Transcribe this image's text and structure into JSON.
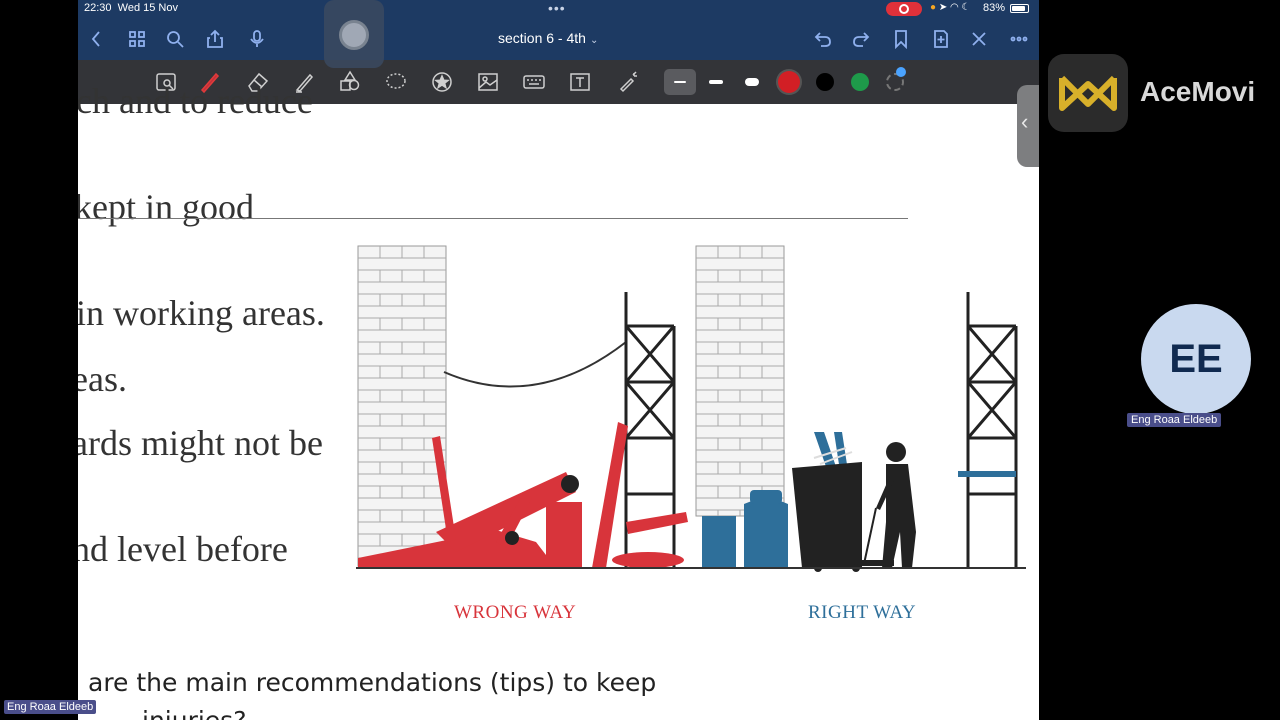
{
  "status_bar": {
    "time": "22:30",
    "date": "Wed 15 Nov",
    "battery": "83%"
  },
  "nav": {
    "title": "section 6 - 4th"
  },
  "document": {
    "lines": [
      "ch and to reduce",
      "kept in good",
      "in working areas.",
      "eas.",
      "ards might not be",
      "nd level before"
    ],
    "caption_wrong": "WRONG WAY",
    "caption_right": "RIGHT WAY",
    "question_line1": "are the main recommendations (tips) to keep",
    "question_line2": "injuries?"
  },
  "recorder": {
    "app_name": "AceMovi"
  },
  "meeting": {
    "avatar_initials": "EE",
    "participant_name": "Eng Roaa Eldeeb",
    "self_name": "Eng Roaa Eldeeb"
  },
  "colors": {
    "navbar": "#1d3a63",
    "toolbar": "#333438",
    "wrong": "#d8343b",
    "right": "#2e6f9a",
    "record": "#e0313a"
  },
  "icons": [
    "back-icon",
    "grid-icon",
    "search-icon",
    "share-icon",
    "microphone-icon",
    "undo-icon",
    "redo-icon",
    "bookmark-icon",
    "add-page-icon",
    "close-icon",
    "more-icon"
  ]
}
